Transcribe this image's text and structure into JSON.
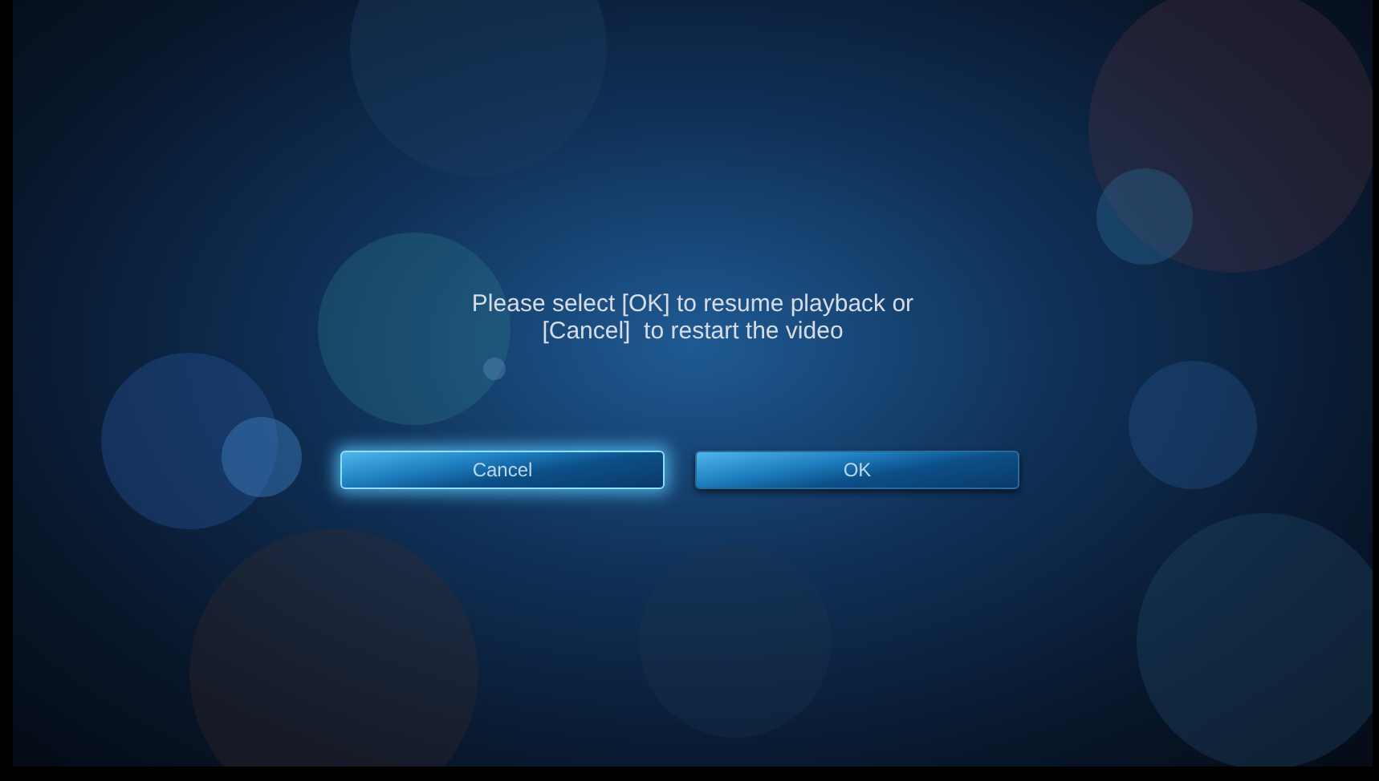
{
  "dialog": {
    "message_lines": [
      "Please select [OK] to resume playback or",
      "[Cancel]  to restart the video"
    ],
    "buttons": [
      {
        "label": "Cancel",
        "selected": true
      },
      {
        "label": "OK",
        "selected": false
      }
    ]
  }
}
